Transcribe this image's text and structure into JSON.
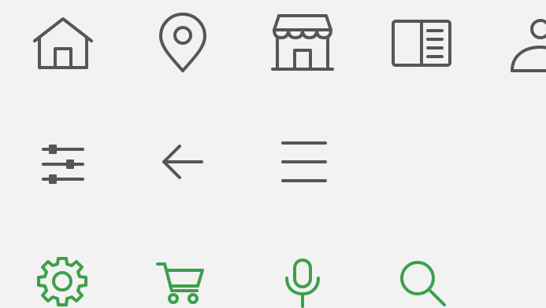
{
  "colors": {
    "icon_grey": "#565656",
    "icon_green": "#3ca04a",
    "background": "#f2f2f2"
  },
  "rows": [
    {
      "icons": [
        "home-icon",
        "location-pin-icon",
        "store-icon",
        "book-open-icon",
        "user-icon"
      ]
    },
    {
      "icons": [
        "sliders-icon",
        "arrow-left-icon",
        "hamburger-menu-icon"
      ]
    },
    {
      "icons": [
        "gear-icon",
        "cart-icon",
        "microphone-icon",
        "search-icon"
      ]
    }
  ]
}
